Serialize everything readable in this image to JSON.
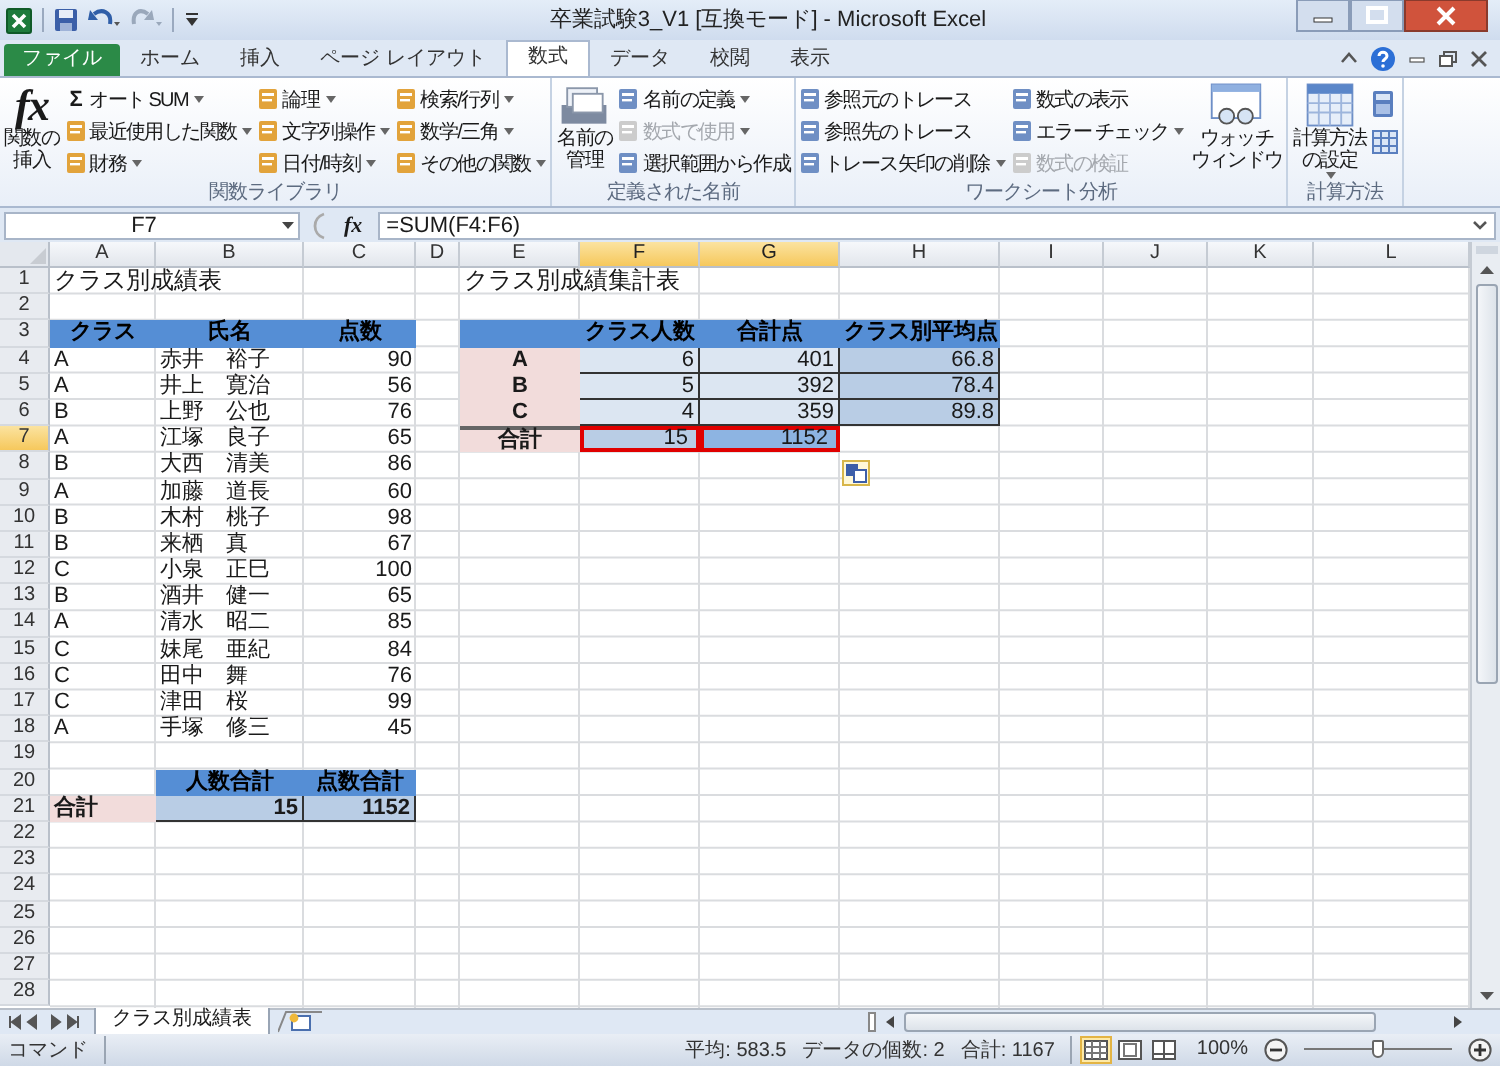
{
  "window": {
    "title": "卒業試験3_V1  [互換モード] - Microsoft Excel"
  },
  "tabs": [
    {
      "label": "ファイル",
      "kind": "file",
      "selected": false
    },
    {
      "label": "ホーム",
      "kind": "tab",
      "selected": false
    },
    {
      "label": "挿入",
      "kind": "tab",
      "selected": false
    },
    {
      "label": "ページ レイアウト",
      "kind": "tab",
      "selected": false
    },
    {
      "label": "数式",
      "kind": "tab",
      "selected": true
    },
    {
      "label": "データ",
      "kind": "tab",
      "selected": false
    },
    {
      "label": "校閲",
      "kind": "tab",
      "selected": false
    },
    {
      "label": "表示",
      "kind": "tab",
      "selected": false
    }
  ],
  "ribbon": {
    "groups": [
      {
        "label": "関数ライブラリ",
        "parts": [
          {
            "kind": "fx",
            "icon_text": "fx",
            "lines": [
              "関数の",
              "挿入"
            ],
            "dropdown": false
          },
          {
            "kind": "stack",
            "items": [
              {
                "label": "オート SUM",
                "icon_text": "Σ",
                "dropdown": true,
                "disabled": false
              },
              {
                "label": "最近使用した関数",
                "dropdown": true,
                "disabled": false
              },
              {
                "label": "財務",
                "dropdown": true,
                "disabled": false
              }
            ]
          },
          {
            "kind": "stack",
            "items": [
              {
                "label": "論理",
                "dropdown": true,
                "disabled": false
              },
              {
                "label": "文字列操作",
                "dropdown": true,
                "disabled": false
              },
              {
                "label": "日付/時刻",
                "dropdown": true,
                "disabled": false
              }
            ]
          },
          {
            "kind": "stack",
            "items": [
              {
                "label": "検索/行列",
                "dropdown": true,
                "disabled": false
              },
              {
                "label": "数学/三角",
                "dropdown": true,
                "disabled": false
              },
              {
                "label": "その他の関数",
                "dropdown": true,
                "disabled": false
              }
            ]
          }
        ]
      },
      {
        "label": "定義された名前",
        "parts": [
          {
            "kind": "names",
            "lines": [
              "名前の",
              "管理"
            ],
            "dropdown": false
          },
          {
            "kind": "stack",
            "items": [
              {
                "label": "名前の定義",
                "dropdown": true,
                "disabled": false
              },
              {
                "label": "数式で使用",
                "dropdown": true,
                "disabled": true
              },
              {
                "label": "選択範囲から作成",
                "dropdown": false,
                "disabled": false
              }
            ]
          }
        ]
      },
      {
        "label": "ワークシート分析",
        "parts": [
          {
            "kind": "stack",
            "items": [
              {
                "label": "参照元のトレース",
                "dropdown": false,
                "disabled": false
              },
              {
                "label": "参照先のトレース",
                "dropdown": false,
                "disabled": false
              },
              {
                "label": "トレース矢印の削除",
                "dropdown": true,
                "disabled": false
              }
            ]
          },
          {
            "kind": "stack",
            "items": [
              {
                "label": "数式の表示",
                "dropdown": false,
                "disabled": false
              },
              {
                "label": "エラー チェック",
                "dropdown": true,
                "disabled": false
              },
              {
                "label": "数式の検証",
                "dropdown": false,
                "disabled": true
              }
            ]
          },
          {
            "kind": "watch",
            "lines": [
              "ウォッチ",
              "ウィンドウ"
            ],
            "dropdown": false
          }
        ]
      },
      {
        "label": "計算方法",
        "parts": [
          {
            "kind": "calc",
            "lines": [
              "計算方法",
              "の設定"
            ],
            "dropdown": true
          },
          {
            "kind": "icons"
          }
        ]
      }
    ]
  },
  "formula_bar": {
    "name_box": "F7",
    "fx": "fx",
    "formula": "=SUM(F4:F6)"
  },
  "sheet": {
    "columns": [
      {
        "label": "A",
        "selected": false
      },
      {
        "label": "B",
        "selected": false
      },
      {
        "label": "C",
        "selected": false
      },
      {
        "label": "D",
        "selected": false
      },
      {
        "label": "E",
        "selected": false
      },
      {
        "label": "F",
        "selected": true
      },
      {
        "label": "G",
        "selected": true
      },
      {
        "label": "H",
        "selected": false
      },
      {
        "label": "I",
        "selected": false
      },
      {
        "label": "J",
        "selected": false
      },
      {
        "label": "K",
        "selected": false
      },
      {
        "label": "L",
        "selected": false
      }
    ],
    "rows": [
      {
        "number": "1",
        "selected": false,
        "cells": [
          {
            "text": "クラス別成績表",
            "kind": "title"
          },
          null,
          null,
          null,
          {
            "text": "クラス別成績集計表",
            "kind": "title"
          }
        ]
      },
      {
        "number": "2",
        "selected": false
      },
      {
        "number": "3",
        "selected": false,
        "cells": [
          {
            "text": "クラス",
            "kind": "header"
          },
          {
            "text": "氏名",
            "kind": "header"
          },
          {
            "text": "点数",
            "kind": "header"
          },
          null,
          {
            "kind": "header"
          },
          {
            "text": "クラス人数",
            "kind": "header"
          },
          {
            "text": "合計点",
            "kind": "header"
          },
          {
            "text": "クラス別平均点",
            "kind": "header"
          }
        ]
      },
      {
        "number": "4",
        "selected": false,
        "cells": [
          {
            "text": "A",
            "kind": "text"
          },
          {
            "text": "赤井　裕子",
            "kind": "text"
          },
          {
            "text": "90",
            "kind": "number"
          },
          null,
          {
            "text": "A",
            "kind": "label"
          },
          {
            "text": "6",
            "kind": "value"
          },
          {
            "text": "401",
            "kind": "value"
          },
          {
            "text": "66.8",
            "kind": "average"
          }
        ]
      },
      {
        "number": "5",
        "selected": false,
        "cells": [
          {
            "text": "A",
            "kind": "text"
          },
          {
            "text": "井上　寛治",
            "kind": "text"
          },
          {
            "text": "56",
            "kind": "number"
          },
          null,
          {
            "text": "B",
            "kind": "label"
          },
          {
            "text": "5",
            "kind": "value"
          },
          {
            "text": "392",
            "kind": "value"
          },
          {
            "text": "78.4",
            "kind": "average"
          }
        ]
      },
      {
        "number": "6",
        "selected": false,
        "cells": [
          {
            "text": "B",
            "kind": "text"
          },
          {
            "text": "上野　公也",
            "kind": "text"
          },
          {
            "text": "76",
            "kind": "number"
          },
          null,
          {
            "text": "C",
            "kind": "label"
          },
          {
            "text": "4",
            "kind": "value"
          },
          {
            "text": "359",
            "kind": "value"
          },
          {
            "text": "89.8",
            "kind": "average"
          }
        ]
      },
      {
        "number": "7",
        "selected": true,
        "cells": [
          {
            "text": "A",
            "kind": "text"
          },
          {
            "text": "江塚　良子",
            "kind": "text"
          },
          {
            "text": "65",
            "kind": "number"
          },
          null,
          {
            "text": "合計",
            "kind": "label-total"
          },
          {
            "text": "15",
            "kind": "sum-active"
          },
          {
            "text": "1152",
            "kind": "sum-selected"
          }
        ]
      },
      {
        "number": "8",
        "selected": false,
        "cells": [
          {
            "text": "B",
            "kind": "text"
          },
          {
            "text": "大西　清美",
            "kind": "text"
          },
          {
            "text": "86",
            "kind": "number"
          }
        ]
      },
      {
        "number": "9",
        "selected": false,
        "cells": [
          {
            "text": "A",
            "kind": "text"
          },
          {
            "text": "加藤　道長",
            "kind": "text"
          },
          {
            "text": "60",
            "kind": "number"
          }
        ]
      },
      {
        "number": "10",
        "selected": false,
        "cells": [
          {
            "text": "B",
            "kind": "text"
          },
          {
            "text": "木村　桃子",
            "kind": "text"
          },
          {
            "text": "98",
            "kind": "number"
          }
        ]
      },
      {
        "number": "11",
        "selected": false,
        "cells": [
          {
            "text": "B",
            "kind": "text"
          },
          {
            "text": "来栖　真",
            "kind": "text"
          },
          {
            "text": "67",
            "kind": "number"
          }
        ]
      },
      {
        "number": "12",
        "selected": false,
        "cells": [
          {
            "text": "C",
            "kind": "text"
          },
          {
            "text": "小泉　正巳",
            "kind": "text"
          },
          {
            "text": "100",
            "kind": "number"
          }
        ]
      },
      {
        "number": "13",
        "selected": false,
        "cells": [
          {
            "text": "B",
            "kind": "text"
          },
          {
            "text": "酒井　健一",
            "kind": "text"
          },
          {
            "text": "65",
            "kind": "number"
          }
        ]
      },
      {
        "number": "14",
        "selected": false,
        "cells": [
          {
            "text": "A",
            "kind": "text"
          },
          {
            "text": "清水　昭二",
            "kind": "text"
          },
          {
            "text": "85",
            "kind": "number"
          }
        ]
      },
      {
        "number": "15",
        "selected": false,
        "cells": [
          {
            "text": "C",
            "kind": "text"
          },
          {
            "text": "妹尾　亜紀",
            "kind": "text"
          },
          {
            "text": "84",
            "kind": "number"
          }
        ]
      },
      {
        "number": "16",
        "selected": false,
        "cells": [
          {
            "text": "C",
            "kind": "text"
          },
          {
            "text": "田中　舞",
            "kind": "text"
          },
          {
            "text": "76",
            "kind": "number"
          }
        ]
      },
      {
        "number": "17",
        "selected": false,
        "cells": [
          {
            "text": "C",
            "kind": "text"
          },
          {
            "text": "津田　桜",
            "kind": "text"
          },
          {
            "text": "99",
            "kind": "number"
          }
        ]
      },
      {
        "number": "18",
        "selected": false,
        "cells": [
          {
            "text": "A",
            "kind": "text"
          },
          {
            "text": "手塚　修三",
            "kind": "text"
          },
          {
            "text": "45",
            "kind": "number"
          }
        ]
      },
      {
        "number": "19",
        "selected": false
      },
      {
        "number": "20",
        "selected": false,
        "cells": [
          null,
          {
            "text": "人数合計",
            "kind": "header"
          },
          {
            "text": "点数合計",
            "kind": "header"
          }
        ]
      },
      {
        "number": "21",
        "selected": false,
        "cells": [
          {
            "text": "合計",
            "kind": "label-left"
          },
          {
            "text": "15",
            "kind": "total"
          },
          {
            "text": "1152",
            "kind": "total"
          }
        ]
      },
      {
        "number": "22",
        "selected": false
      },
      {
        "number": "23",
        "selected": false
      },
      {
        "number": "24",
        "selected": false
      },
      {
        "number": "25",
        "selected": false
      },
      {
        "number": "26",
        "selected": false
      },
      {
        "number": "27",
        "selected": false
      },
      {
        "number": "28",
        "selected": false
      }
    ]
  },
  "sheet_tabs": [
    {
      "label": "クラス別成績表",
      "selected": true
    }
  ],
  "status_bar": {
    "mode": "コマンド",
    "stats": [
      "平均: 583.5",
      "データの個数: 2",
      "合計: 1167"
    ],
    "view_buttons": [
      {
        "kind": "normal",
        "selected": true
      },
      {
        "kind": "layout",
        "selected": false
      },
      {
        "kind": "break",
        "selected": false
      }
    ],
    "zoom": {
      "label": "100%",
      "level": 0.5
    }
  }
}
